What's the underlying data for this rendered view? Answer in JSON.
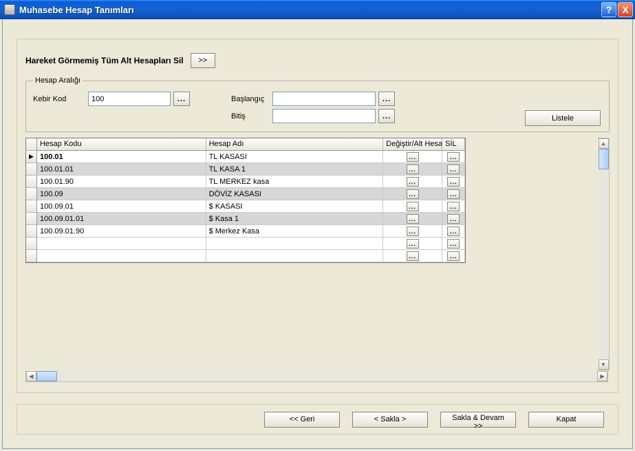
{
  "window": {
    "title": "Muhasebe Hesap Tanımları"
  },
  "header": {
    "section_title": "Hareket Görmemiş Tüm Alt Hesapları Sil",
    "go_label": ">>"
  },
  "range": {
    "legend": "Hesap Aralığı",
    "kebir_label": "Kebir Kod",
    "kebir_value": "100",
    "baslangic_label": "Başlangıç",
    "baslangic_value": "",
    "bitis_label": "Bitiş",
    "bitis_value": "",
    "liste_label": "Listele"
  },
  "grid": {
    "columns": {
      "code": "Hesap Kodu",
      "name": "Hesap Adı",
      "change": "Değiştir/Alt Hesap",
      "sil": "SİL"
    },
    "rows": [
      {
        "code": "100.01",
        "name": "TL KASASI",
        "alt": false,
        "current": true
      },
      {
        "code": "100.01.01",
        "name": "TL KASA 1",
        "alt": true,
        "current": false
      },
      {
        "code": "100.01.90",
        "name": "TL MERKEZ kasa",
        "alt": false,
        "current": false
      },
      {
        "code": "100.09",
        "name": "DÖVİZ KASASI",
        "alt": true,
        "current": false
      },
      {
        "code": "100.09.01",
        "name": "$ KASASI",
        "alt": false,
        "current": false
      },
      {
        "code": "100.09.01.01",
        "name": "$ Kasa 1",
        "alt": true,
        "current": false
      },
      {
        "code": "100.09.01.90",
        "name": "$ Merkez Kasa",
        "alt": false,
        "current": false
      },
      {
        "code": "",
        "name": "",
        "alt": false,
        "current": false
      },
      {
        "code": "",
        "name": "",
        "alt": false,
        "current": false
      }
    ]
  },
  "footer": {
    "back": "<< Geri",
    "save": "< Sakla >",
    "save_continue": "Sakla & Devam >>",
    "close": "Kapat"
  },
  "glyphs": {
    "ellipsis": "...",
    "help": "?",
    "close": "X",
    "up": "▲",
    "down": "▼",
    "left": "◀",
    "right": "▶",
    "current": "▶"
  }
}
